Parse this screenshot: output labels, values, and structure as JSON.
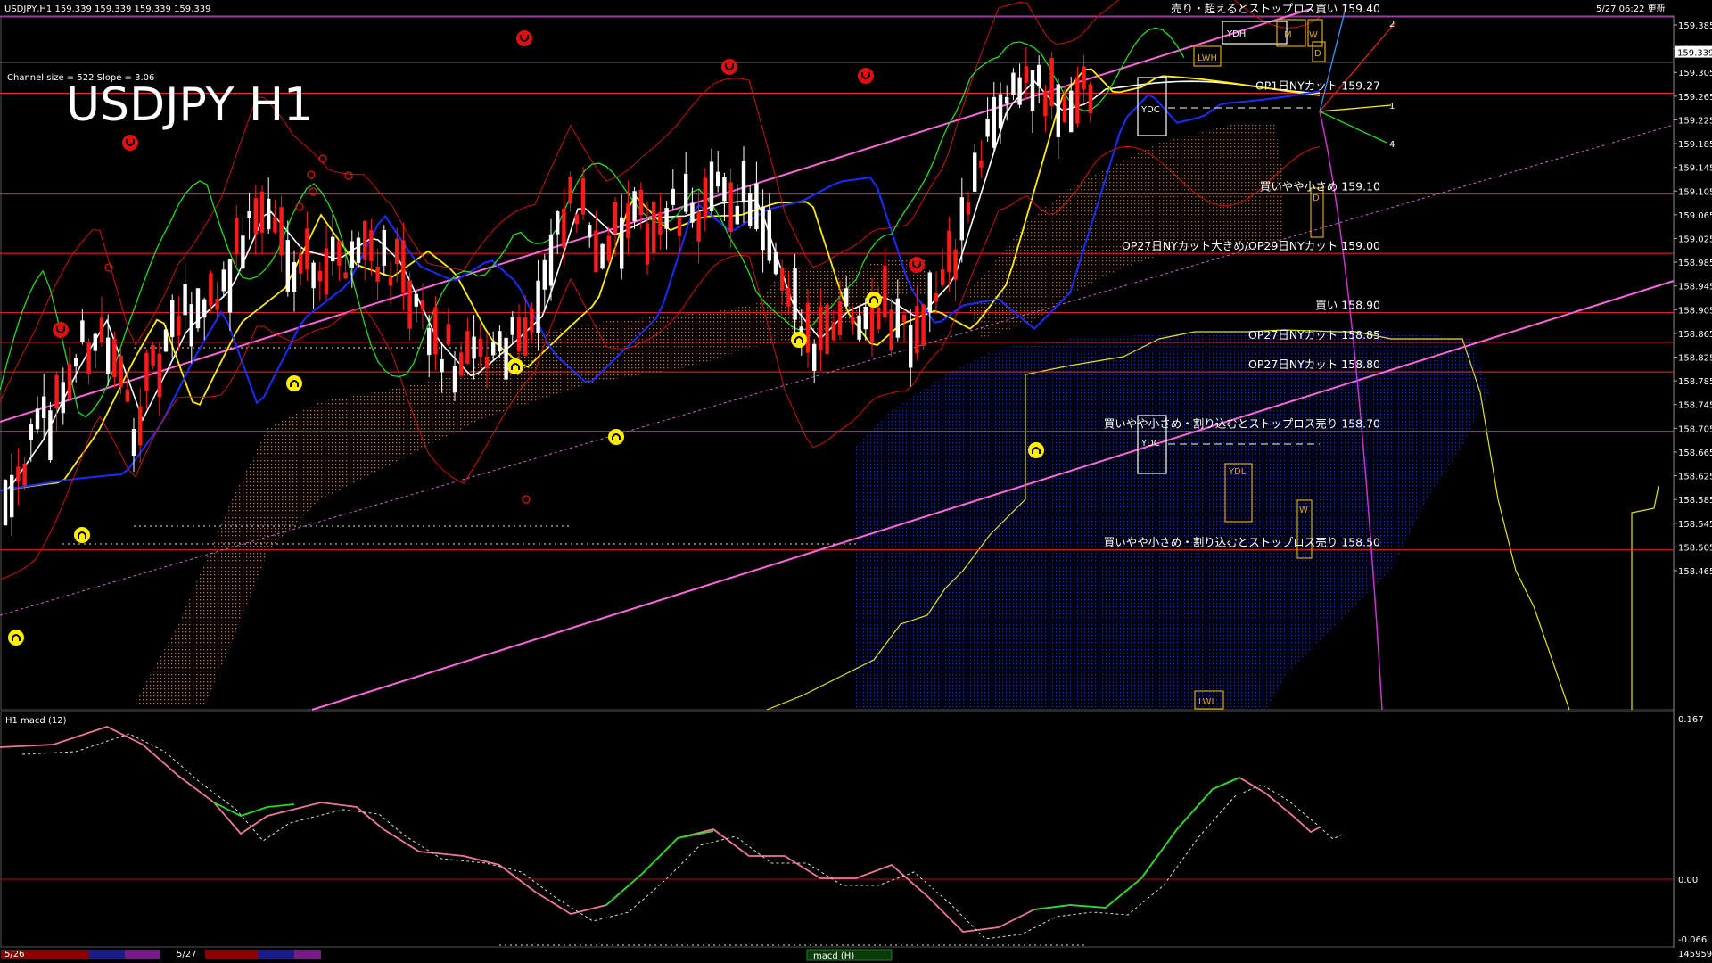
{
  "window": {
    "header": "USDJPY,H1  159.339 159.339 159.339 159.339",
    "clock": "5/27 06:22 更新"
  },
  "chart_info": {
    "channel": "Channel size = 522 Slope = 3.06",
    "title": "USDJPY H1"
  },
  "price_axis": {
    "ticks": [
      "159.385",
      "159.345",
      "159.305",
      "159.265",
      "159.225",
      "159.185",
      "159.145",
      "159.105",
      "159.065",
      "159.025",
      "158.985",
      "158.945",
      "158.905",
      "158.865",
      "158.825",
      "158.785",
      "158.745",
      "158.705",
      "158.665",
      "158.625",
      "158.585",
      "158.545",
      "158.505",
      "158.465"
    ],
    "current": "159.339"
  },
  "levels": [
    {
      "price": 159.4,
      "label": "売り・超えるとストップロス買い 159.40",
      "color": "#ff2222"
    },
    {
      "price": 159.27,
      "label": "OP1日NYカット 159.27",
      "color": "#ff2222"
    },
    {
      "price": 159.1,
      "label": "買いやや小さめ 159.10",
      "color": "#ff2222"
    },
    {
      "price": 159.0,
      "label": "OP27日NYカット大きめ/OP29日NYカット 159.00",
      "color": "#ff2222"
    },
    {
      "price": 158.9,
      "label": "買い 158.90",
      "color": "#ff2222"
    },
    {
      "price": 158.85,
      "label": "OP27日NYカット 158.85",
      "color": "#ff2222"
    },
    {
      "price": 158.8,
      "label": "OP27日NYカット 158.80",
      "color": "#ff2222"
    },
    {
      "price": 158.7,
      "label": "買いやや小さめ・割り込むとストップロス売り 158.70",
      "color": "#ff2222"
    },
    {
      "price": 158.5,
      "label": "買いやや小さめ・割り込むとストップロス売り 158.50",
      "color": "#ff2222"
    }
  ],
  "box_labels": {
    "ydh": "YDH",
    "ydc_top": "YDC",
    "ydc_low": "YDC",
    "ydl": "YDL",
    "lwh": "LWH",
    "lwl": "LWL",
    "m": "M",
    "w1": "W",
    "w2": "W",
    "d1": "D",
    "d2": "D"
  },
  "fan_labels": [
    "1",
    "2",
    "4"
  ],
  "macd": {
    "label": "H1  macd (12)",
    "top": "0.167",
    "zero": "0.00",
    "bottom": "-0.066"
  },
  "time_axis": {
    "d1": "5/26",
    "d2": "5/27",
    "count": "145959",
    "tab": "macd (H)"
  },
  "colors": {
    "bull": "#ffffff",
    "bear": "#ff1a1a",
    "grid": "#cc0000",
    "pink": "#ff66dd",
    "yellow": "#ffee00",
    "blue": "#1a2cff",
    "green": "#22dd22"
  }
}
